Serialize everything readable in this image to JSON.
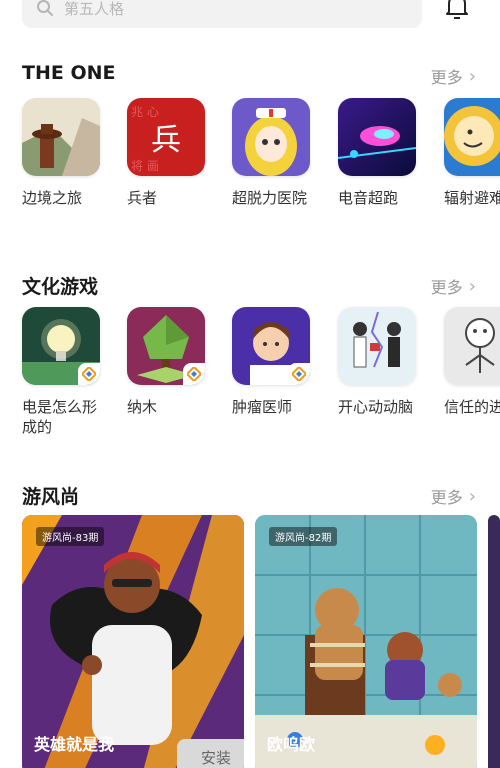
{
  "search": {
    "placeholder": "第五人格"
  },
  "sections": [
    {
      "title": "THE ONE",
      "more": "更多",
      "apps": [
        {
          "name": "边境之旅",
          "icon": "cowboy-desert-icon"
        },
        {
          "name": "兵者",
          "icon": "bing-character-icon"
        },
        {
          "name": "超脱力医院",
          "icon": "nurse-cartoon-icon"
        },
        {
          "name": "电音超跑",
          "icon": "neon-car-icon"
        },
        {
          "name": "辐射避难所",
          "icon": "vault-boy-icon"
        }
      ]
    },
    {
      "title": "文化游戏",
      "more": "更多",
      "apps": [
        {
          "name": "电是怎么形成的",
          "icon": "lightbulb-icon"
        },
        {
          "name": "纳木",
          "icon": "green-tree-icon"
        },
        {
          "name": "肿瘤医师",
          "icon": "doctor-icon"
        },
        {
          "name": "开心动动脑",
          "icon": "couple-sketch-icon"
        },
        {
          "name": "信任的进化",
          "icon": "stick-figure-icon"
        }
      ]
    },
    {
      "title": "游风尚",
      "more": "更多",
      "cards": [
        {
          "tag": "游风尚-83期",
          "title": "英雄就是我",
          "button": "安装"
        },
        {
          "tag": "游风尚-82期",
          "title": "欧呜欧"
        }
      ]
    }
  ],
  "colors": {
    "accent": "#333333",
    "muted": "#9a9a9a",
    "card1": "#5b2a7a",
    "card2": "#6fb8c2"
  }
}
